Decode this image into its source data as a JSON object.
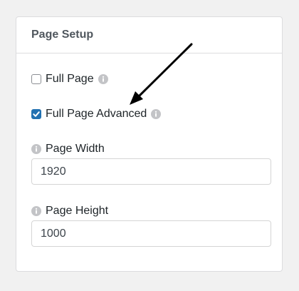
{
  "panel": {
    "title": "Page Setup"
  },
  "options": {
    "full_page": {
      "label": "Full Page",
      "checked": false
    },
    "full_page_advanced": {
      "label": "Full Page Advanced",
      "checked": true
    }
  },
  "fields": {
    "page_width": {
      "label": "Page Width",
      "value": "1920"
    },
    "page_height": {
      "label": "Page Height",
      "value": "1000"
    }
  },
  "colors": {
    "accent": "#2271b1",
    "info_icon": "#c3c4c7",
    "border": "#dcdcde"
  },
  "icons": {
    "info": "info-circle-icon",
    "check": "checkmark-icon",
    "annotation": "arrow-icon"
  }
}
